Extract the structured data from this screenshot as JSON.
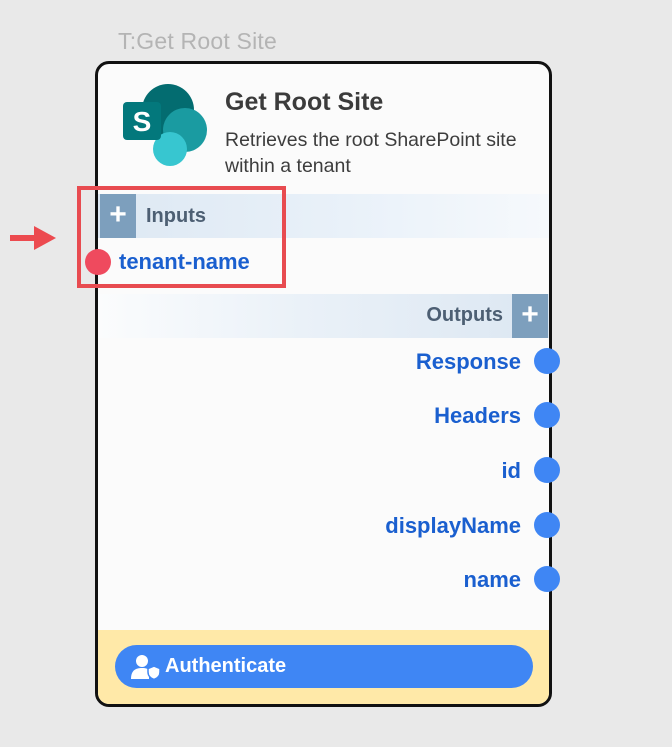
{
  "node": {
    "caption": "T:Get Root Site",
    "title": "Get Root Site",
    "description": "Retrieves the root SharePoint site within a tenant",
    "logo_icon": "sharepoint-logo",
    "logo_letter": "S"
  },
  "inputs": {
    "label": "Inputs",
    "add_symbol": "+",
    "items": [
      {
        "label": "tenant-name",
        "port_color": "#ef4a5e"
      }
    ]
  },
  "outputs": {
    "label": "Outputs",
    "add_symbol": "+",
    "items": [
      {
        "label": "Response"
      },
      {
        "label": "Headers"
      },
      {
        "label": "id"
      },
      {
        "label": "displayName"
      },
      {
        "label": "name"
      }
    ],
    "port_color": "#3f86f4"
  },
  "footer": {
    "auth_label": "Authenticate",
    "auth_icon": "user-shield-icon",
    "background": "#ffe9a8",
    "button_color": "#3f86f4"
  },
  "annotation": {
    "highlight_color": "#e84b50",
    "arrow_icon": "arrow-right-icon"
  }
}
